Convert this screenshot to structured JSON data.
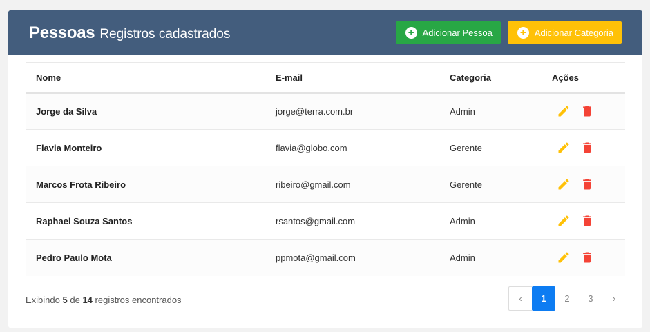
{
  "header": {
    "title": "Pessoas",
    "subtitle": "Registros cadastrados",
    "buttons": {
      "add_person": "Adicionar Pessoa",
      "add_category": "Adicionar Categoria"
    }
  },
  "table": {
    "columns": [
      "Nome",
      "E-mail",
      "Categoria",
      "Ações"
    ],
    "rows": [
      {
        "nome": "Jorge da Silva",
        "email": "jorge@terra.com.br",
        "categoria": "Admin"
      },
      {
        "nome": "Flavia Monteiro",
        "email": "flavia@globo.com",
        "categoria": "Gerente"
      },
      {
        "nome": "Marcos Frota Ribeiro",
        "email": "ribeiro@gmail.com",
        "categoria": "Gerente"
      },
      {
        "nome": "Raphael Souza Santos",
        "email": "rsantos@gmail.com",
        "categoria": "Admin"
      },
      {
        "nome": "Pedro Paulo Mota",
        "email": "ppmota@gmail.com",
        "categoria": "Admin"
      }
    ]
  },
  "footer": {
    "prefix": "Exibindo",
    "shown": "5",
    "middle": "de",
    "total": "14",
    "suffix": "registros encontrados"
  },
  "pagination": {
    "prev": "‹",
    "pages": [
      "1",
      "2",
      "3"
    ],
    "active": "1",
    "next": "›"
  },
  "colors": {
    "header_bg": "#435d7d",
    "success": "#28a745",
    "warning": "#ffc107",
    "edit_icon": "#ffc107",
    "delete_icon": "#f44336",
    "page_active": "#0d7cf2"
  },
  "icons": {
    "add": "plus-circle-icon",
    "edit": "pencil-icon",
    "delete": "trash-icon"
  }
}
